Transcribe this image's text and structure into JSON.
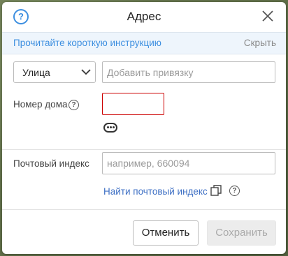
{
  "dialog": {
    "title": "Адрес",
    "help_icon": "question-circle-icon",
    "close_icon": "close-icon"
  },
  "info_bar": {
    "link_text": "Прочитайте короткую инструкцию",
    "hide_text": "Скрыть"
  },
  "street": {
    "type_value": "Улица",
    "binding_placeholder": "Добавить привязку"
  },
  "house": {
    "label": "Номер дома",
    "value": "",
    "error_color": "#cc0000"
  },
  "postal": {
    "label": "Почтовый индекс",
    "placeholder": "например, 660094",
    "find_link": "Найти почтовый индекс"
  },
  "buttons": {
    "cancel": "Отменить",
    "save": "Сохранить"
  },
  "colors": {
    "accent": "#3d8fe0",
    "link": "#3d6fc4",
    "info_bg": "#eef5fc"
  }
}
